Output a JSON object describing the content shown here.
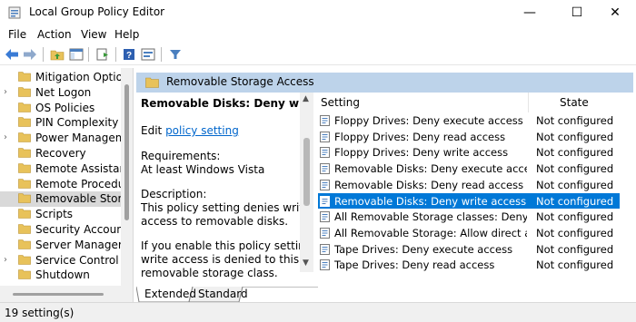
{
  "window": {
    "title": "Local Group Policy Editor",
    "minimize": "—",
    "maximize": "☐",
    "close": "✕"
  },
  "menu": [
    "File",
    "Action",
    "View",
    "Help"
  ],
  "toolbar_icons": [
    "back-arrow-icon",
    "forward-arrow-icon",
    "up-folder-icon",
    "show-hide-tree-icon",
    "export-list-icon",
    "help-icon",
    "properties-icon",
    "filter-icon"
  ],
  "tree": {
    "items": [
      {
        "label": "Mitigation Option",
        "expandable": false,
        "selected": false
      },
      {
        "label": "Net Logon",
        "expandable": true,
        "selected": false
      },
      {
        "label": "OS Policies",
        "expandable": false,
        "selected": false
      },
      {
        "label": "PIN Complexity",
        "expandable": false,
        "selected": false
      },
      {
        "label": "Power Manageme",
        "expandable": true,
        "selected": false
      },
      {
        "label": "Recovery",
        "expandable": false,
        "selected": false
      },
      {
        "label": "Remote Assistance",
        "expandable": false,
        "selected": false
      },
      {
        "label": "Remote Procedure",
        "expandable": false,
        "selected": false
      },
      {
        "label": "Removable Storag",
        "expandable": false,
        "selected": true
      },
      {
        "label": "Scripts",
        "expandable": false,
        "selected": false
      },
      {
        "label": "Security Account I",
        "expandable": false,
        "selected": false
      },
      {
        "label": "Server Manager",
        "expandable": false,
        "selected": false
      },
      {
        "label": "Service Control M",
        "expandable": true,
        "selected": false
      },
      {
        "label": "Shutdown",
        "expandable": false,
        "selected": false
      }
    ]
  },
  "right_header": "Removable Storage Access",
  "description": {
    "policy_title": "Removable Disks: Deny write access",
    "edit_prefix": "Edit ",
    "edit_link": "policy setting",
    "requirements_label": "Requirements:",
    "requirements_value": "At least Windows Vista",
    "description_label": "Description:",
    "description_line1": "This policy setting denies write",
    "description_line2": "access to removable disks.",
    "enable_line1": "If you enable this policy setting,",
    "enable_line2": "write access is denied to this",
    "enable_line3": "removable storage class."
  },
  "list": {
    "col_setting": "Setting",
    "col_state": "State",
    "rows": [
      {
        "name": "Floppy Drives: Deny execute access",
        "state": "Not configured",
        "selected": false
      },
      {
        "name": "Floppy Drives: Deny read access",
        "state": "Not configured",
        "selected": false
      },
      {
        "name": "Floppy Drives: Deny write access",
        "state": "Not configured",
        "selected": false
      },
      {
        "name": "Removable Disks: Deny execute access",
        "state": "Not configured",
        "selected": false
      },
      {
        "name": "Removable Disks: Deny read access",
        "state": "Not configured",
        "selected": false
      },
      {
        "name": "Removable Disks: Deny write access",
        "state": "Not configured",
        "selected": true
      },
      {
        "name": "All Removable Storage classes: Deny all a...",
        "state": "Not configured",
        "selected": false
      },
      {
        "name": "All Removable Storage: Allow direct acce...",
        "state": "Not configured",
        "selected": false
      },
      {
        "name": "Tape Drives: Deny execute access",
        "state": "Not configured",
        "selected": false
      },
      {
        "name": "Tape Drives: Deny read access",
        "state": "Not configured",
        "selected": false
      }
    ]
  },
  "tabs": [
    "Extended",
    "Standard"
  ],
  "status": "19 setting(s)",
  "colors": {
    "selection": "#0078d7",
    "header": "#bdd3ea",
    "folder": "#e8c25a",
    "link": "#0066cc"
  }
}
